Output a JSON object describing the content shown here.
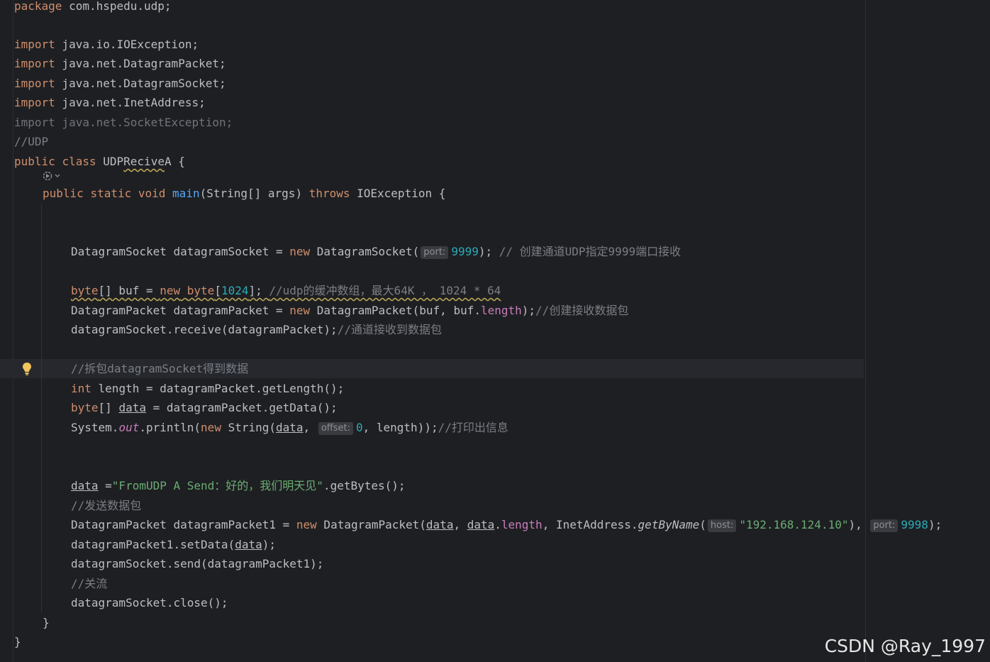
{
  "code": {
    "package_kw": "package",
    "package_name": " com.hspedu.udp;",
    "import_kw": "import",
    "imports": [
      " java.io.IOException;",
      " java.net.DatagramPacket;",
      " java.net.DatagramSocket;",
      " java.net.InetAddress;"
    ],
    "unused_import": "import java.net.SocketException;",
    "comment_udp": "//UDP",
    "class_public": "public",
    "class_kw": "class",
    "class_name_prefix": "UDP",
    "class_name_mid": "Recive",
    "class_name_suffix": "A",
    "brace_open": " {",
    "main_public": "public",
    "main_static": "static",
    "main_void": "void",
    "main_name": "main",
    "main_params": "(String[] args) ",
    "main_throws": "throws",
    "main_exception": " IOException {",
    "socket_decl": "DatagramSocket datagramSocket = ",
    "new_kw": "new",
    "socket_ctor": " DatagramSocket(",
    "hint_port": "port:",
    "port_recv": "9999",
    "socket_end": "); ",
    "socket_comment": "// 创建通道UDP指定9999端口接收",
    "byte_kw": "byte",
    "buf_decl": "[] buf = ",
    "buf_num": "1024",
    "buf_end": "]; ",
    "buf_comment": "//udp的缓冲数组，最大64K ， 1024 * 64",
    "packet_decl": "DatagramPacket datagramPacket = ",
    "packet_ctor": " DatagramPacket(buf, buf.",
    "length_field": "length",
    "packet_end": ");",
    "packet_comment": "//创建接收数据包",
    "receive_stmt": "datagramSocket.receive(datagramPacket);",
    "receive_comment": "//通道接收到数据包",
    "unpack_comment": "//拆包datagramSocket得到数据",
    "int_kw": "int",
    "length_stmt": " length = datagramPacket.getLength();",
    "data_var": "data",
    "data_stmt": " = datagramPacket.getData();",
    "println_prefix": "System.",
    "out_field": "out",
    "println_call": ".println(",
    "string_ctor": " String(",
    "comma": ", ",
    "hint_offset": "offset:",
    "offset_val": "0",
    "println_end": ", length));",
    "print_comment": "//打印出信息",
    "assign_eq": " =",
    "send_string": "\"FromUDP A Send：好的，我们明天见\"",
    "get_bytes": ".getBytes();",
    "send_comment": "//发送数据包",
    "packet1_decl": "DatagramPacket datagramPacket1 = ",
    "packet1_ctor": " DatagramPacket(",
    "dot": ".",
    "inet_call": "InetAddress.",
    "get_by_name": "getByName",
    "open_paren": "(",
    "hint_host": "host:",
    "host_val": "\"192.168.124.10\"",
    "close_comma": "), ",
    "port_send": "9998",
    "stmt_end": ");",
    "set_data_prefix": "datagramPacket1.setData(",
    "send_stmt": "datagramSocket.send(datagramPacket1);",
    "close_comment": "//关流",
    "close_stmt": "datagramSocket.close();",
    "brace_close": "}"
  },
  "watermark": "CSDN @Ray_1997",
  "icons": {
    "bulb": "lightbulb-icon",
    "run": "run-gutter-icon"
  },
  "colors": {
    "background": "#1e1f22",
    "keyword": "#cf8e6d",
    "function": "#56a8f5",
    "number": "#2aacb8",
    "string": "#6aab73",
    "comment": "#7a7e85",
    "field": "#c77dbb"
  }
}
